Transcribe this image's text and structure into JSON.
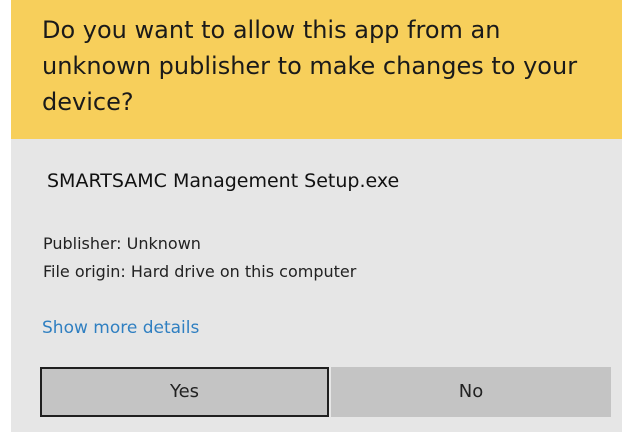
{
  "dialog": {
    "question": "Do you want to allow this app from an unknown publisher to make changes to your device?",
    "app_name": "SMARTSAMC Management Setup.exe",
    "publisher": "Publisher: Unknown",
    "file_origin": "File origin: Hard drive on this computer",
    "details_link": "Show more details",
    "yes_label": "Yes",
    "no_label": "No"
  },
  "colors": {
    "banner": "#f7cf5b",
    "background": "#e6e6e6",
    "link": "#2f7fc1",
    "button": "#c4c4c4"
  }
}
